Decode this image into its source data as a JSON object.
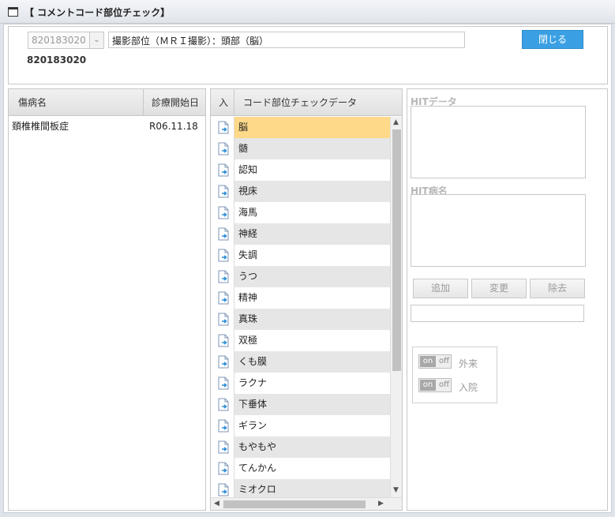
{
  "window": {
    "title": "【 コメントコード部位チェック】"
  },
  "header": {
    "code_select_value": "820183020",
    "name_field_value": "撮影部位（ＭＲＩ撮影）：頭部（脳）",
    "close_label": "閉じる",
    "code_display": "820183020"
  },
  "disease_table": {
    "columns": [
      "傷病名",
      "診療開始日"
    ],
    "rows": [
      {
        "name": "頚椎椎間板症",
        "start_date": "R06.11.18"
      }
    ]
  },
  "check_table": {
    "columns": [
      "入",
      "コード部位チェックデータ"
    ],
    "rows": [
      "脳",
      "髄",
      "認知",
      "視床",
      "海馬",
      "神経",
      "失調",
      "うつ",
      "精神",
      "真珠",
      "双極",
      "くも膜",
      "ラクナ",
      "下垂体",
      "ギラン",
      "もやもや",
      "てんかん",
      "ミオクロ"
    ],
    "selected_index": 0
  },
  "right_panel": {
    "hit_data_label": "HITデータ",
    "hit_disease_label": "HIT病名",
    "add_label": "追加",
    "change_label": "変更",
    "remove_label": "除去",
    "toggles": [
      {
        "on_text": "on",
        "off_text": "off",
        "label": "外来"
      },
      {
        "on_text": "on",
        "off_text": "off",
        "label": "入院"
      }
    ]
  },
  "colors": {
    "accent": "#3aa0e3",
    "selected_row": "#ffd98a",
    "alt_row": "#e6e6e6"
  }
}
